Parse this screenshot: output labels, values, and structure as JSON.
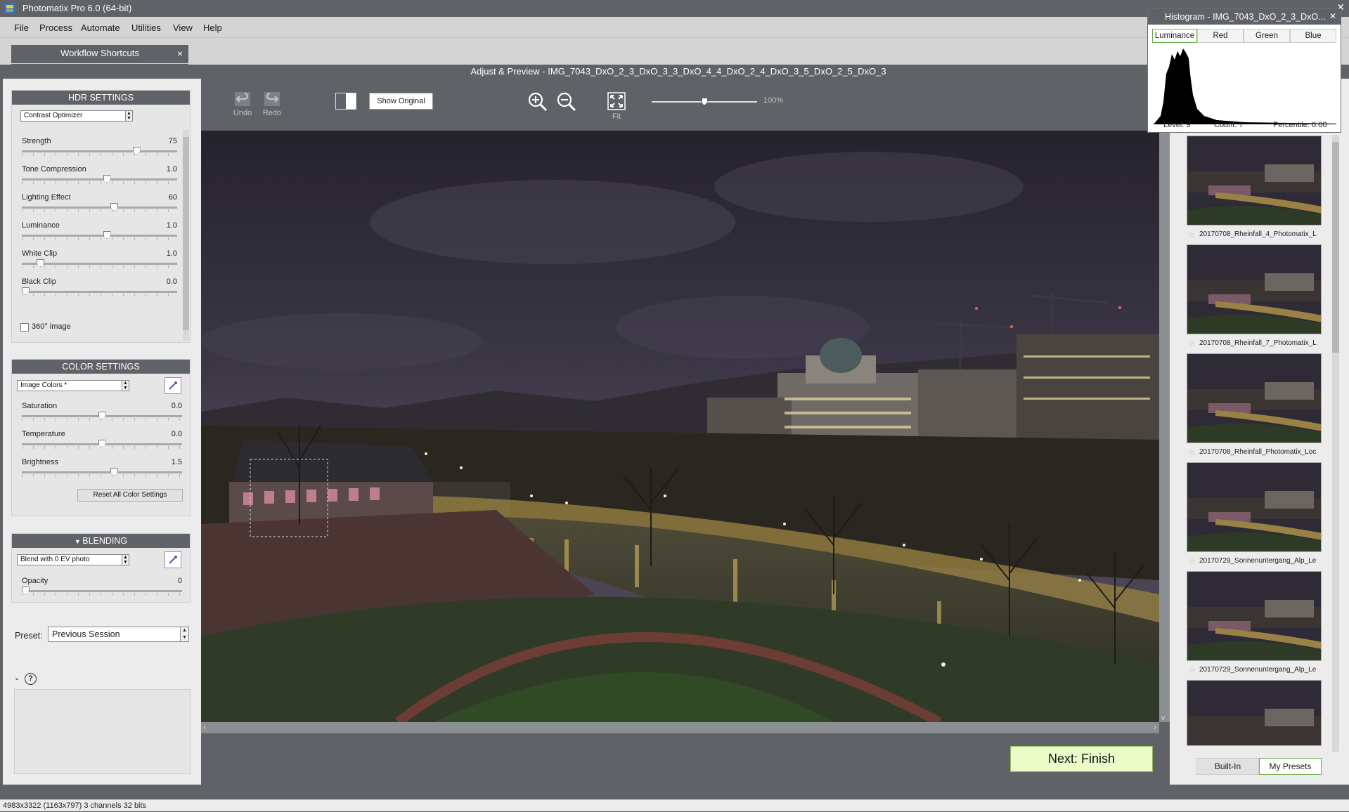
{
  "app": {
    "title": "Photomatix Pro 6.0 (64-bit)"
  },
  "menu": [
    "File",
    "Process",
    "Automate",
    "Utilities",
    "View",
    "Help"
  ],
  "workflow_tab": {
    "label": "Workflow Shortcuts",
    "close": "×"
  },
  "preview_title": "Adjust & Preview - IMG_7043_DxO_2_3_DxO_3_3_DxO_4_4_DxO_2_4_DxO_3_5_DxO_2_5_DxO_3",
  "toolbar": {
    "undo": "Undo",
    "redo": "Redo",
    "show_original": "Show Original",
    "fit": "Fit",
    "zoom": "100%",
    "zoom_fraction": 0.5
  },
  "hdr": {
    "title": "HDR SETTINGS",
    "method": "Contrast Optimizer",
    "sliders": [
      {
        "label": "Strength",
        "value": "75",
        "pos": 0.75
      },
      {
        "label": "Tone Compression",
        "value": "1.0",
        "pos": 0.55
      },
      {
        "label": "Lighting Effect",
        "value": "60",
        "pos": 0.6
      },
      {
        "label": "Luminance",
        "value": "1.0",
        "pos": 0.55
      },
      {
        "label": "White Clip",
        "value": "1.0",
        "pos": 0.1
      },
      {
        "label": "Black Clip",
        "value": "0.0",
        "pos": 0.0
      }
    ],
    "checkbox_360": "360° image"
  },
  "color": {
    "title": "COLOR SETTINGS",
    "mode": "Image Colors *",
    "sliders": [
      {
        "label": "Saturation",
        "value": "0.0",
        "pos": 0.5
      },
      {
        "label": "Temperature",
        "value": "0.0",
        "pos": 0.5
      },
      {
        "label": "Brightness",
        "value": "1.5",
        "pos": 0.58
      }
    ],
    "reset": "Reset All Color Settings"
  },
  "blending": {
    "title": "BLENDING",
    "mode": "Blend with 0 EV photo",
    "slider": {
      "label": "Opacity",
      "value": "0",
      "pos": 0.0
    }
  },
  "preset": {
    "label": "Preset:",
    "value": "Previous Session"
  },
  "histogram": {
    "title": "Histogram - IMG_7043_DxO_2_3_DxO...",
    "tabs": [
      "Luminance",
      "Red",
      "Green",
      "Blue"
    ],
    "level": "Level: 9",
    "count": "Count: 7",
    "percentile": "Percentile: 0.00"
  },
  "thumbs": [
    "20170708_Rheinfall_4_Photomatix_L",
    "20170708_Rheinfall_7_Photomatix_L",
    "20170708_Rheinfall_Photomatix_Loc",
    "20170729_Sonnenuntergang_Alp_Le",
    "20170729_Sonnenuntergang_Alp_Le"
  ],
  "preset_tabs": {
    "builtin": "Built-In",
    "mine": "My Presets"
  },
  "next_button": "Next: Finish",
  "status": "4983x3322 (1163x797) 3 channels 32 bits",
  "colors": {
    "panel_header": "#5f6266",
    "next_bg": "#ecfcc9",
    "accent_green": "#6ab04c"
  }
}
